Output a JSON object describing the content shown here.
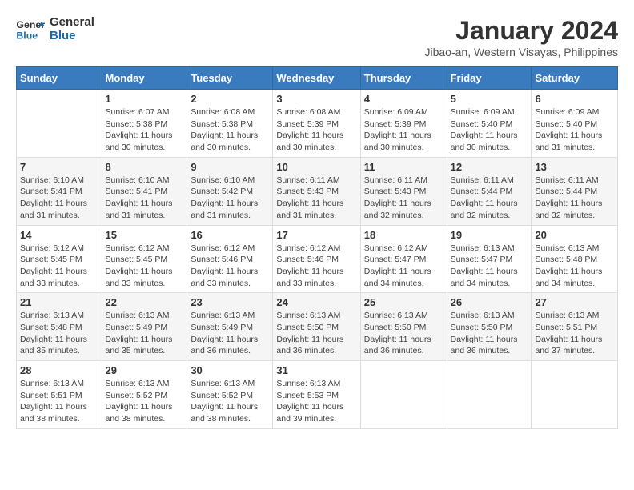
{
  "header": {
    "logo_line1": "General",
    "logo_line2": "Blue",
    "month": "January 2024",
    "location": "Jibao-an, Western Visayas, Philippines"
  },
  "columns": [
    "Sunday",
    "Monday",
    "Tuesday",
    "Wednesday",
    "Thursday",
    "Friday",
    "Saturday"
  ],
  "weeks": [
    [
      {
        "day": "",
        "info": ""
      },
      {
        "day": "1",
        "info": "Sunrise: 6:07 AM\nSunset: 5:38 PM\nDaylight: 11 hours\nand 30 minutes."
      },
      {
        "day": "2",
        "info": "Sunrise: 6:08 AM\nSunset: 5:38 PM\nDaylight: 11 hours\nand 30 minutes."
      },
      {
        "day": "3",
        "info": "Sunrise: 6:08 AM\nSunset: 5:39 PM\nDaylight: 11 hours\nand 30 minutes."
      },
      {
        "day": "4",
        "info": "Sunrise: 6:09 AM\nSunset: 5:39 PM\nDaylight: 11 hours\nand 30 minutes."
      },
      {
        "day": "5",
        "info": "Sunrise: 6:09 AM\nSunset: 5:40 PM\nDaylight: 11 hours\nand 30 minutes."
      },
      {
        "day": "6",
        "info": "Sunrise: 6:09 AM\nSunset: 5:40 PM\nDaylight: 11 hours\nand 31 minutes."
      }
    ],
    [
      {
        "day": "7",
        "info": "Sunrise: 6:10 AM\nSunset: 5:41 PM\nDaylight: 11 hours\nand 31 minutes."
      },
      {
        "day": "8",
        "info": "Sunrise: 6:10 AM\nSunset: 5:41 PM\nDaylight: 11 hours\nand 31 minutes."
      },
      {
        "day": "9",
        "info": "Sunrise: 6:10 AM\nSunset: 5:42 PM\nDaylight: 11 hours\nand 31 minutes."
      },
      {
        "day": "10",
        "info": "Sunrise: 6:11 AM\nSunset: 5:43 PM\nDaylight: 11 hours\nand 31 minutes."
      },
      {
        "day": "11",
        "info": "Sunrise: 6:11 AM\nSunset: 5:43 PM\nDaylight: 11 hours\nand 32 minutes."
      },
      {
        "day": "12",
        "info": "Sunrise: 6:11 AM\nSunset: 5:44 PM\nDaylight: 11 hours\nand 32 minutes."
      },
      {
        "day": "13",
        "info": "Sunrise: 6:11 AM\nSunset: 5:44 PM\nDaylight: 11 hours\nand 32 minutes."
      }
    ],
    [
      {
        "day": "14",
        "info": "Sunrise: 6:12 AM\nSunset: 5:45 PM\nDaylight: 11 hours\nand 33 minutes."
      },
      {
        "day": "15",
        "info": "Sunrise: 6:12 AM\nSunset: 5:45 PM\nDaylight: 11 hours\nand 33 minutes."
      },
      {
        "day": "16",
        "info": "Sunrise: 6:12 AM\nSunset: 5:46 PM\nDaylight: 11 hours\nand 33 minutes."
      },
      {
        "day": "17",
        "info": "Sunrise: 6:12 AM\nSunset: 5:46 PM\nDaylight: 11 hours\nand 33 minutes."
      },
      {
        "day": "18",
        "info": "Sunrise: 6:12 AM\nSunset: 5:47 PM\nDaylight: 11 hours\nand 34 minutes."
      },
      {
        "day": "19",
        "info": "Sunrise: 6:13 AM\nSunset: 5:47 PM\nDaylight: 11 hours\nand 34 minutes."
      },
      {
        "day": "20",
        "info": "Sunrise: 6:13 AM\nSunset: 5:48 PM\nDaylight: 11 hours\nand 34 minutes."
      }
    ],
    [
      {
        "day": "21",
        "info": "Sunrise: 6:13 AM\nSunset: 5:48 PM\nDaylight: 11 hours\nand 35 minutes."
      },
      {
        "day": "22",
        "info": "Sunrise: 6:13 AM\nSunset: 5:49 PM\nDaylight: 11 hours\nand 35 minutes."
      },
      {
        "day": "23",
        "info": "Sunrise: 6:13 AM\nSunset: 5:49 PM\nDaylight: 11 hours\nand 36 minutes."
      },
      {
        "day": "24",
        "info": "Sunrise: 6:13 AM\nSunset: 5:50 PM\nDaylight: 11 hours\nand 36 minutes."
      },
      {
        "day": "25",
        "info": "Sunrise: 6:13 AM\nSunset: 5:50 PM\nDaylight: 11 hours\nand 36 minutes."
      },
      {
        "day": "26",
        "info": "Sunrise: 6:13 AM\nSunset: 5:50 PM\nDaylight: 11 hours\nand 36 minutes."
      },
      {
        "day": "27",
        "info": "Sunrise: 6:13 AM\nSunset: 5:51 PM\nDaylight: 11 hours\nand 37 minutes."
      }
    ],
    [
      {
        "day": "28",
        "info": "Sunrise: 6:13 AM\nSunset: 5:51 PM\nDaylight: 11 hours\nand 38 minutes."
      },
      {
        "day": "29",
        "info": "Sunrise: 6:13 AM\nSunset: 5:52 PM\nDaylight: 11 hours\nand 38 minutes."
      },
      {
        "day": "30",
        "info": "Sunrise: 6:13 AM\nSunset: 5:52 PM\nDaylight: 11 hours\nand 38 minutes."
      },
      {
        "day": "31",
        "info": "Sunrise: 6:13 AM\nSunset: 5:53 PM\nDaylight: 11 hours\nand 39 minutes."
      },
      {
        "day": "",
        "info": ""
      },
      {
        "day": "",
        "info": ""
      },
      {
        "day": "",
        "info": ""
      }
    ]
  ]
}
